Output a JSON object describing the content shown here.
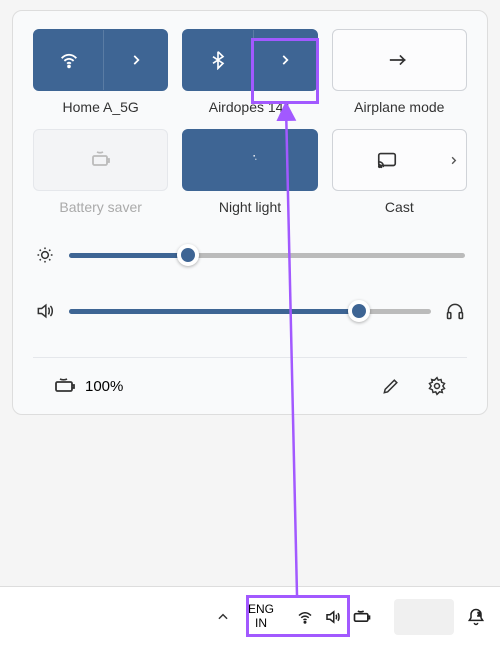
{
  "tiles": {
    "wifi": {
      "label": "Home A_5G",
      "active": true
    },
    "bluetooth": {
      "label": "Airdopes 141",
      "active": true
    },
    "airplane": {
      "label": "Airplane mode",
      "active": false
    },
    "battery_saver": {
      "label": "Battery saver",
      "active": false,
      "disabled": true
    },
    "night_light": {
      "label": "Night light",
      "active": true
    },
    "cast": {
      "label": "Cast",
      "active": false
    }
  },
  "sliders": {
    "brightness": 30,
    "volume": 80
  },
  "footer": {
    "battery_percent": "100%"
  },
  "taskbar": {
    "language_line1": "ENG",
    "language_line2": "IN"
  },
  "colors": {
    "accent": "#3e6594",
    "highlight": "#a259ff"
  }
}
